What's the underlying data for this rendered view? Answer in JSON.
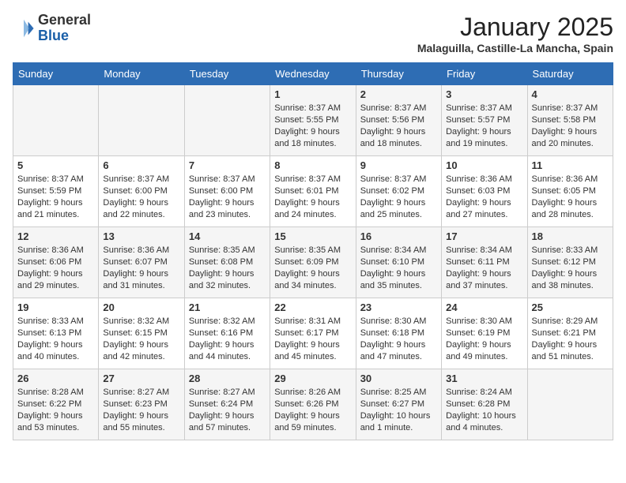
{
  "header": {
    "logo_general": "General",
    "logo_blue": "Blue",
    "month_title": "January 2025",
    "location": "Malaguilla, Castille-La Mancha, Spain"
  },
  "calendar": {
    "days_of_week": [
      "Sunday",
      "Monday",
      "Tuesday",
      "Wednesday",
      "Thursday",
      "Friday",
      "Saturday"
    ],
    "weeks": [
      [
        {
          "day": "",
          "content": ""
        },
        {
          "day": "",
          "content": ""
        },
        {
          "day": "",
          "content": ""
        },
        {
          "day": "1",
          "content": "Sunrise: 8:37 AM\nSunset: 5:55 PM\nDaylight: 9 hours\nand 18 minutes."
        },
        {
          "day": "2",
          "content": "Sunrise: 8:37 AM\nSunset: 5:56 PM\nDaylight: 9 hours\nand 18 minutes."
        },
        {
          "day": "3",
          "content": "Sunrise: 8:37 AM\nSunset: 5:57 PM\nDaylight: 9 hours\nand 19 minutes."
        },
        {
          "day": "4",
          "content": "Sunrise: 8:37 AM\nSunset: 5:58 PM\nDaylight: 9 hours\nand 20 minutes."
        }
      ],
      [
        {
          "day": "5",
          "content": "Sunrise: 8:37 AM\nSunset: 5:59 PM\nDaylight: 9 hours\nand 21 minutes."
        },
        {
          "day": "6",
          "content": "Sunrise: 8:37 AM\nSunset: 6:00 PM\nDaylight: 9 hours\nand 22 minutes."
        },
        {
          "day": "7",
          "content": "Sunrise: 8:37 AM\nSunset: 6:00 PM\nDaylight: 9 hours\nand 23 minutes."
        },
        {
          "day": "8",
          "content": "Sunrise: 8:37 AM\nSunset: 6:01 PM\nDaylight: 9 hours\nand 24 minutes."
        },
        {
          "day": "9",
          "content": "Sunrise: 8:37 AM\nSunset: 6:02 PM\nDaylight: 9 hours\nand 25 minutes."
        },
        {
          "day": "10",
          "content": "Sunrise: 8:36 AM\nSunset: 6:03 PM\nDaylight: 9 hours\nand 27 minutes."
        },
        {
          "day": "11",
          "content": "Sunrise: 8:36 AM\nSunset: 6:05 PM\nDaylight: 9 hours\nand 28 minutes."
        }
      ],
      [
        {
          "day": "12",
          "content": "Sunrise: 8:36 AM\nSunset: 6:06 PM\nDaylight: 9 hours\nand 29 minutes."
        },
        {
          "day": "13",
          "content": "Sunrise: 8:36 AM\nSunset: 6:07 PM\nDaylight: 9 hours\nand 31 minutes."
        },
        {
          "day": "14",
          "content": "Sunrise: 8:35 AM\nSunset: 6:08 PM\nDaylight: 9 hours\nand 32 minutes."
        },
        {
          "day": "15",
          "content": "Sunrise: 8:35 AM\nSunset: 6:09 PM\nDaylight: 9 hours\nand 34 minutes."
        },
        {
          "day": "16",
          "content": "Sunrise: 8:34 AM\nSunset: 6:10 PM\nDaylight: 9 hours\nand 35 minutes."
        },
        {
          "day": "17",
          "content": "Sunrise: 8:34 AM\nSunset: 6:11 PM\nDaylight: 9 hours\nand 37 minutes."
        },
        {
          "day": "18",
          "content": "Sunrise: 8:33 AM\nSunset: 6:12 PM\nDaylight: 9 hours\nand 38 minutes."
        }
      ],
      [
        {
          "day": "19",
          "content": "Sunrise: 8:33 AM\nSunset: 6:13 PM\nDaylight: 9 hours\nand 40 minutes."
        },
        {
          "day": "20",
          "content": "Sunrise: 8:32 AM\nSunset: 6:15 PM\nDaylight: 9 hours\nand 42 minutes."
        },
        {
          "day": "21",
          "content": "Sunrise: 8:32 AM\nSunset: 6:16 PM\nDaylight: 9 hours\nand 44 minutes."
        },
        {
          "day": "22",
          "content": "Sunrise: 8:31 AM\nSunset: 6:17 PM\nDaylight: 9 hours\nand 45 minutes."
        },
        {
          "day": "23",
          "content": "Sunrise: 8:30 AM\nSunset: 6:18 PM\nDaylight: 9 hours\nand 47 minutes."
        },
        {
          "day": "24",
          "content": "Sunrise: 8:30 AM\nSunset: 6:19 PM\nDaylight: 9 hours\nand 49 minutes."
        },
        {
          "day": "25",
          "content": "Sunrise: 8:29 AM\nSunset: 6:21 PM\nDaylight: 9 hours\nand 51 minutes."
        }
      ],
      [
        {
          "day": "26",
          "content": "Sunrise: 8:28 AM\nSunset: 6:22 PM\nDaylight: 9 hours\nand 53 minutes."
        },
        {
          "day": "27",
          "content": "Sunrise: 8:27 AM\nSunset: 6:23 PM\nDaylight: 9 hours\nand 55 minutes."
        },
        {
          "day": "28",
          "content": "Sunrise: 8:27 AM\nSunset: 6:24 PM\nDaylight: 9 hours\nand 57 minutes."
        },
        {
          "day": "29",
          "content": "Sunrise: 8:26 AM\nSunset: 6:26 PM\nDaylight: 9 hours\nand 59 minutes."
        },
        {
          "day": "30",
          "content": "Sunrise: 8:25 AM\nSunset: 6:27 PM\nDaylight: 10 hours\nand 1 minute."
        },
        {
          "day": "31",
          "content": "Sunrise: 8:24 AM\nSunset: 6:28 PM\nDaylight: 10 hours\nand 4 minutes."
        },
        {
          "day": "",
          "content": ""
        }
      ]
    ]
  }
}
